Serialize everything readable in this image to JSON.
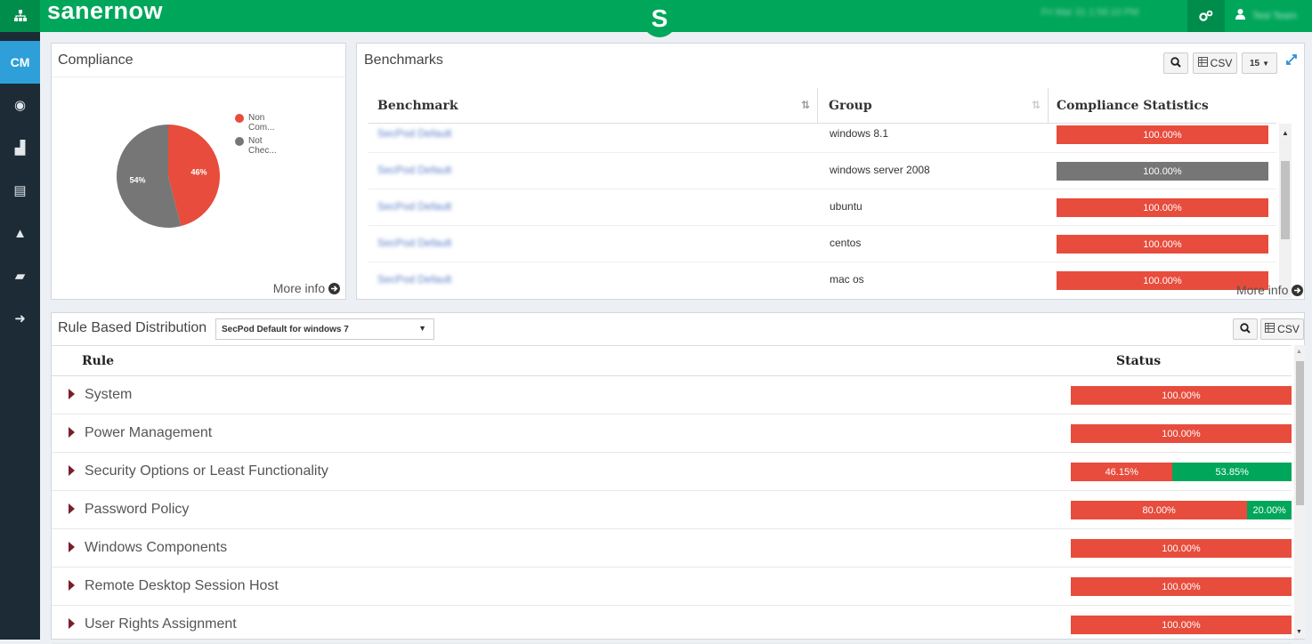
{
  "colors": {
    "topbar": "#00a65a",
    "sidebar": "#1c2b36",
    "red": "#e74c3c",
    "green": "#00a65a",
    "gray": "#767676",
    "active": "#2e9fd8"
  },
  "app": {
    "brand": "sanernow",
    "center_logo": "S",
    "datetime": "Fri Mar 31 1:56:10 PM",
    "user_name": "Test Team"
  },
  "sidebar": {
    "items": [
      {
        "label": "CM",
        "icon": "cm-text-icon"
      },
      {
        "label": "◉",
        "icon": "eye-icon"
      },
      {
        "label": "▟",
        "icon": "building-icon"
      },
      {
        "label": "▤",
        "icon": "list-icon"
      },
      {
        "label": "▲",
        "icon": "warning-icon"
      },
      {
        "label": "▰",
        "icon": "tag-icon"
      },
      {
        "label": "➜",
        "icon": "logout-icon"
      }
    ]
  },
  "compliance": {
    "title": "Compliance",
    "more_info": "More info",
    "legend": [
      {
        "label_line1": "Non",
        "label_line2": "Com...",
        "color": "#e74c3c"
      },
      {
        "label_line1": "Not",
        "label_line2": "Chec...",
        "color": "#767676"
      }
    ],
    "pie_labels": {
      "red": "46%",
      "gray": "54%"
    }
  },
  "chart_data": {
    "type": "pie",
    "categories": [
      "Non Com...",
      "Not Chec..."
    ],
    "values": [
      46,
      54
    ],
    "colors": [
      "#e74c3c",
      "#767676"
    ]
  },
  "benchmarks": {
    "title": "Benchmarks",
    "csv_label": "CSV",
    "page_size": "15",
    "more_info": "More info",
    "columns": [
      "Benchmark",
      "Group",
      "Compliance Statistics"
    ],
    "rows": [
      {
        "benchmark": "SecPod Default",
        "group": "windows 8.1",
        "stat": "100.00%",
        "color": "#e74c3c"
      },
      {
        "benchmark": "SecPod Default",
        "group": "windows server 2008",
        "stat": "100.00%",
        "color": "#767676"
      },
      {
        "benchmark": "SecPod Default",
        "group": "ubuntu",
        "stat": "100.00%",
        "color": "#e74c3c"
      },
      {
        "benchmark": "SecPod Default",
        "group": "centos",
        "stat": "100.00%",
        "color": "#e74c3c"
      },
      {
        "benchmark": "SecPod Default",
        "group": "mac os",
        "stat": "100.00%",
        "color": "#e74c3c"
      }
    ]
  },
  "rbd": {
    "title": "Rule Based Distribution",
    "selected": "SecPod Default for windows 7",
    "csv_label": "CSV",
    "columns": [
      "Rule",
      "Status"
    ],
    "rows": [
      {
        "name": "System",
        "red": 100,
        "green": 0,
        "red_label": "100.00%",
        "green_label": ""
      },
      {
        "name": "Power Management",
        "red": 100,
        "green": 0,
        "red_label": "100.00%",
        "green_label": ""
      },
      {
        "name": "Security Options or Least Functionality",
        "red": 46.15,
        "green": 53.85,
        "red_label": "46.15%",
        "green_label": "53.85%"
      },
      {
        "name": "Password Policy",
        "red": 80,
        "green": 20,
        "red_label": "80.00%",
        "green_label": "20.00%"
      },
      {
        "name": "Windows Components",
        "red": 100,
        "green": 0,
        "red_label": "100.00%",
        "green_label": ""
      },
      {
        "name": "Remote Desktop Session Host",
        "red": 100,
        "green": 0,
        "red_label": "100.00%",
        "green_label": ""
      },
      {
        "name": "User Rights Assignment",
        "red": 100,
        "green": 0,
        "red_label": "100.00%",
        "green_label": ""
      }
    ]
  }
}
